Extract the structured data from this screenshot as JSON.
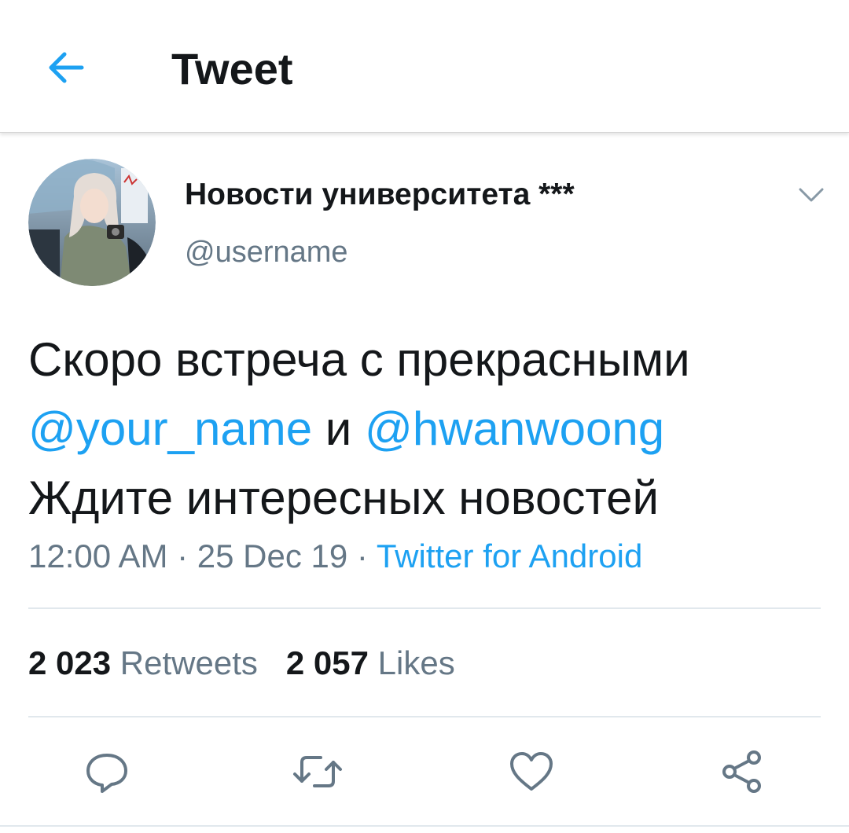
{
  "header": {
    "title": "Tweet",
    "back_icon": "arrow-left-icon",
    "accent_color": "#1da1f2"
  },
  "author": {
    "display_name": "Новости университета ***",
    "handle": "@username",
    "avatar": "avatar-photo"
  },
  "tweet": {
    "line1": "Скоро встреча с прекрасными",
    "mention1": "@your_name",
    "conjunction": " и ",
    "mention2": "@hwanwoong",
    "line3": "Ждите интересных новостей",
    "time": "12:00 AM",
    "separator": " · ",
    "date": "25 Dec 19",
    "source": "Twitter for Android"
  },
  "stats": {
    "retweets_count": "2 023",
    "retweets_label": "Retweets",
    "likes_count": "2 057",
    "likes_label": "Likes"
  },
  "actions": {
    "reply_icon": "reply-icon",
    "retweet_icon": "retweet-icon",
    "like_icon": "heart-icon",
    "share_icon": "share-icon"
  },
  "colors": {
    "text_primary": "#14171a",
    "text_secondary": "#657786",
    "link": "#1da1f2",
    "divider": "#e1e8ed"
  }
}
